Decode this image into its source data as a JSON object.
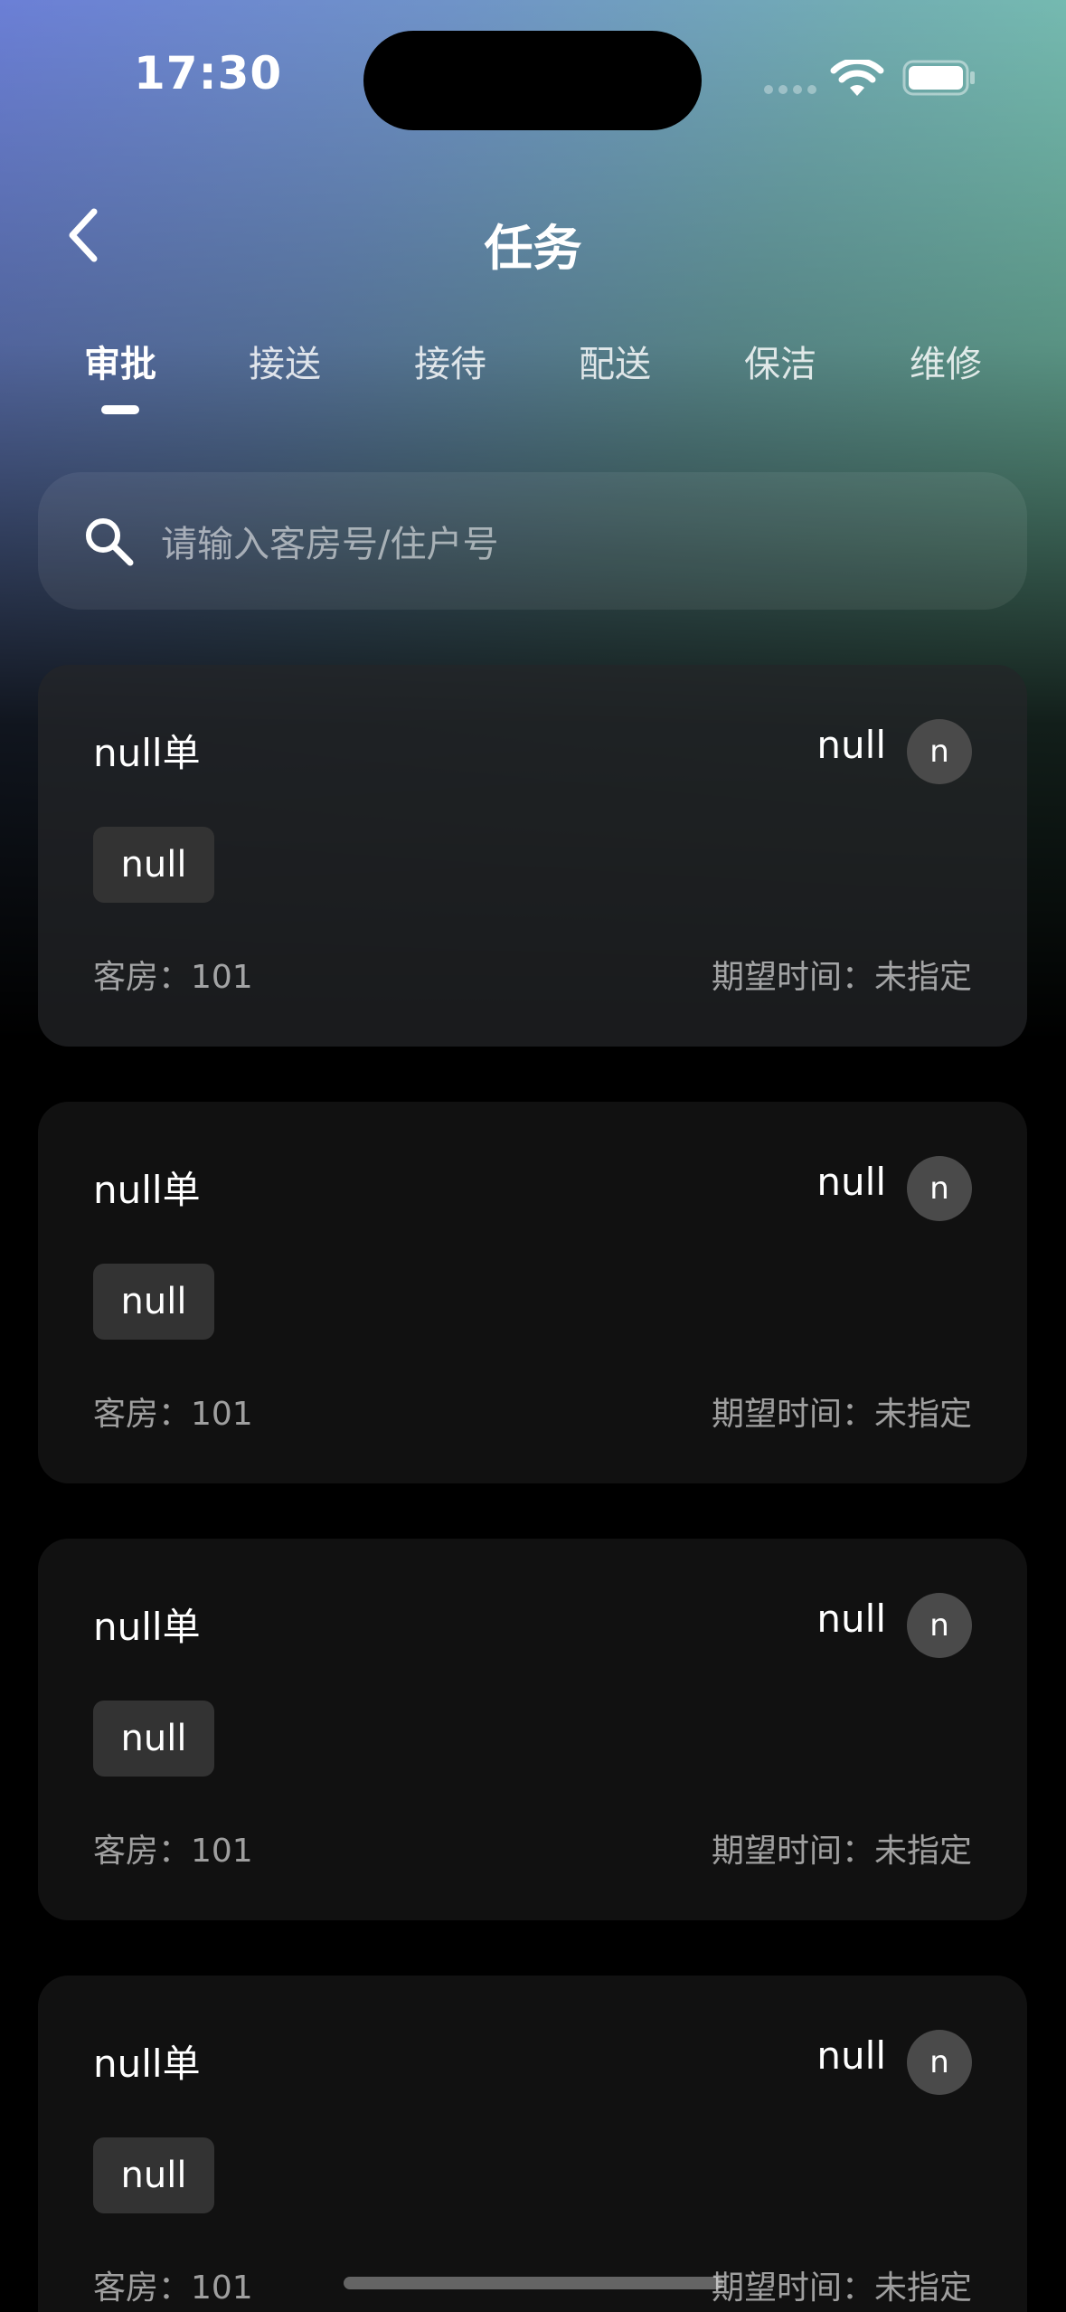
{
  "status_bar": {
    "time": "17:30"
  },
  "nav": {
    "title": "任务"
  },
  "tabs": [
    {
      "label": "审批",
      "active": true
    },
    {
      "label": "接送",
      "active": false
    },
    {
      "label": "接待",
      "active": false
    },
    {
      "label": "配送",
      "active": false
    },
    {
      "label": "保洁",
      "active": false
    },
    {
      "label": "维修",
      "active": false
    }
  ],
  "search": {
    "placeholder": "请输入客房号/住户号"
  },
  "tasks": [
    {
      "title": "null单",
      "assignee": "null",
      "avatar_initial": "n",
      "tag": "null",
      "room": "客房：101",
      "expected_time": "期望时间：未指定"
    },
    {
      "title": "null单",
      "assignee": "null",
      "avatar_initial": "n",
      "tag": "null",
      "room": "客房：101",
      "expected_time": "期望时间：未指定"
    },
    {
      "title": "null单",
      "assignee": "null",
      "avatar_initial": "n",
      "tag": "null",
      "room": "客房：101",
      "expected_time": "期望时间：未指定"
    },
    {
      "title": "null单",
      "assignee": "null",
      "avatar_initial": "n",
      "tag": "null",
      "room": "客房：101",
      "expected_time": "期望时间：未指定"
    }
  ],
  "colors": {
    "gradient_left": "#6b7fd6",
    "gradient_right": "#7dd2b0",
    "background": "#000000",
    "card": "#111111",
    "tag": "#333333",
    "avatar": "#4a4a4a"
  },
  "icons": {
    "back": "chevron-left-icon",
    "search": "search-icon",
    "wifi": "wifi-icon",
    "battery": "battery-icon"
  }
}
